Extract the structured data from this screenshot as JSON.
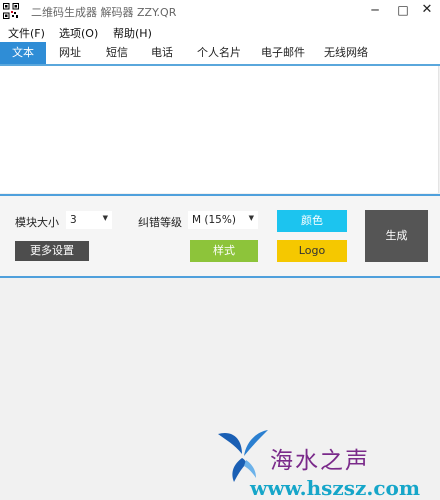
{
  "window": {
    "title": "二维码生成器 解码器 ZZY.QR",
    "app_icon": "qr-code-icon",
    "minimize_glyph": "─",
    "maximize_glyph": "□",
    "close_glyph": "✕"
  },
  "menubar": {
    "items": [
      {
        "label": "文件(F)"
      },
      {
        "label": "选项(O)"
      },
      {
        "label": "帮助(H)"
      }
    ]
  },
  "tabs": {
    "items": [
      {
        "label": "文本",
        "active": true
      },
      {
        "label": "网址",
        "active": false
      },
      {
        "label": "短信",
        "active": false
      },
      {
        "label": "电话",
        "active": false
      },
      {
        "label": "个人名片",
        "active": false
      },
      {
        "label": "电子邮件",
        "active": false
      },
      {
        "label": "无线网络",
        "active": false
      }
    ]
  },
  "editor": {
    "value": ""
  },
  "controls": {
    "module_size_label": "模块大小",
    "module_size_value": "3",
    "error_level_label": "纠错等级",
    "error_level_value": "M (15%)",
    "more_settings_label": "更多设置",
    "style_label": "样式",
    "color_label": "颜色",
    "logo_label": "Logo",
    "generate_label": "生成",
    "dropdown_icon": "caret-down-icon"
  },
  "watermark": {
    "text": "海水之声",
    "url": "www.hszsz.com"
  },
  "colors": {
    "tab_active": "#2f8dd6",
    "accent_line": "#4fa0dc",
    "more_settings_bg": "#4d4d4d",
    "style_bg": "#8dc43a",
    "color_bg": "#1cc4ef",
    "logo_bg": "#f5c800",
    "generate_bg": "#555555"
  }
}
